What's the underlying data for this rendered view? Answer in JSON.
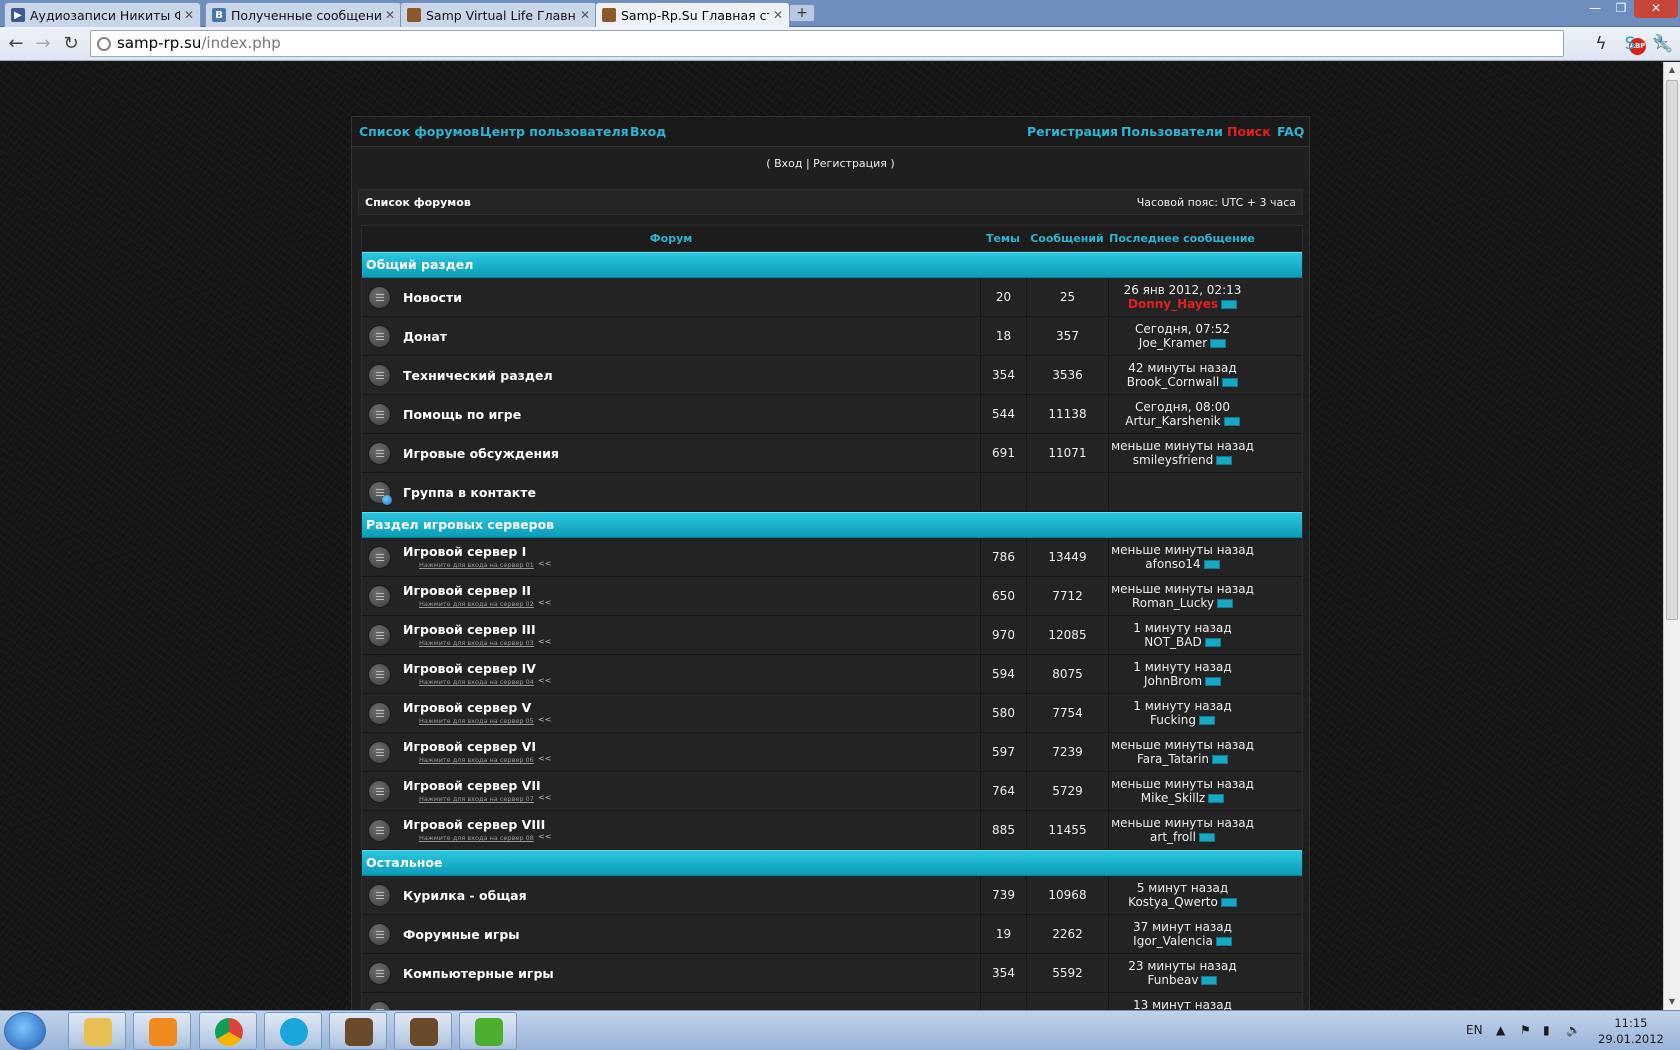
{
  "browser": {
    "tabs": [
      {
        "label": "Аудиозаписи Никиты Фом",
        "favicon": "play-icon",
        "color": "#3a5b8c"
      },
      {
        "label": "Полученные сообщения |",
        "favicon": "vk-icon",
        "color": "#4a76a8"
      },
      {
        "label": "Samp Virtual Life Главная с",
        "favicon": "samp-icon",
        "color": "#8a5a2a"
      },
      {
        "label": "Samp-Rp.Su Главная стран",
        "favicon": "samp-icon",
        "color": "#8a5a2a"
      }
    ],
    "url_host": "samp-rp.su",
    "url_path": "/index.php",
    "abp_label": "ABP"
  },
  "forum": {
    "nav_left": [
      "Список форумов",
      "Центр пользователя",
      "Вход"
    ],
    "nav_right": [
      "Регистрация",
      "Пользователи",
      "Поиск",
      "FAQ"
    ],
    "login_line": "( Вход | Регистрация )",
    "breadcrumb": "Список форумов",
    "timezone": "Часовой пояс: UTC + 3 часа",
    "columns": {
      "forum": "Форум",
      "topics": "Темы",
      "posts": "Сообщений",
      "last": "Последнее сообщение"
    },
    "categories": [
      {
        "title": "Общий раздел",
        "forums": [
          {
            "name": "Новости",
            "topics": "20",
            "posts": "25",
            "last_time": "26 янв 2012, 02:13",
            "last_user": "Donny_Hayes",
            "user_red": true
          },
          {
            "name": "Донат",
            "topics": "18",
            "posts": "357",
            "last_time": "Сегодня, 07:52",
            "last_user": "Joe_Kramer"
          },
          {
            "name": "Технический раздел",
            "topics": "354",
            "posts": "3536",
            "last_time": "42 минуты назад",
            "last_user": "Brook_Cornwall"
          },
          {
            "name": "Помощь по игре",
            "topics": "544",
            "posts": "11138",
            "last_time": "Сегодня, 08:00",
            "last_user": "Artur_Karshenik"
          },
          {
            "name": "Игровые обсуждения",
            "topics": "691",
            "posts": "11071",
            "last_time": "меньше минуты назад",
            "last_user": "smileysfriend"
          },
          {
            "name": "Группа в контакте",
            "link": true
          }
        ]
      },
      {
        "title": "Раздел игровых серверов",
        "forums": [
          {
            "name": "Игровой сервер I",
            "sub": "Нажмите для входа на сервер 01",
            "topics": "786",
            "posts": "13449",
            "last_time": "меньше минуты назад",
            "last_user": "afonso14"
          },
          {
            "name": "Игровой сервер II",
            "sub": "Нажмите для входа на сервер 02",
            "topics": "650",
            "posts": "7712",
            "last_time": "меньше минуты назад",
            "last_user": "Roman_Lucky"
          },
          {
            "name": "Игровой сервер III",
            "sub": "Нажмите для входа на сервер 03",
            "topics": "970",
            "posts": "12085",
            "last_time": "1 минуту назад",
            "last_user": "NOT_BAD"
          },
          {
            "name": "Игровой сервер IV",
            "sub": "Нажмите для входа на сервер 04",
            "topics": "594",
            "posts": "8075",
            "last_time": "1 минуту назад",
            "last_user": "JohnBrom"
          },
          {
            "name": "Игровой сервер V",
            "sub": "Нажмите для входа на сервер 05",
            "topics": "580",
            "posts": "7754",
            "last_time": "1 минуту назад",
            "last_user": "Fucking"
          },
          {
            "name": "Игровой сервер VI",
            "sub": "Нажмите для входа на сервер 06",
            "topics": "597",
            "posts": "7239",
            "last_time": "меньше минуты назад",
            "last_user": "Fara_Tatarin"
          },
          {
            "name": "Игровой сервер VII",
            "sub": "Нажмите для входа на сервер 07",
            "topics": "764",
            "posts": "5729",
            "last_time": "меньше минуты назад",
            "last_user": "Mike_Skillz"
          },
          {
            "name": "Игровой сервер VIII",
            "sub": "Нажмите для входа на сервер 08",
            "topics": "885",
            "posts": "11455",
            "last_time": "меньше минуты назад",
            "last_user": "art_froll"
          }
        ]
      },
      {
        "title": "Остальное",
        "forums": [
          {
            "name": "Курилка - общая",
            "topics": "739",
            "posts": "10968",
            "last_time": "5 минут назад",
            "last_user": "Kostya_Qwerto"
          },
          {
            "name": "Форумные игры",
            "topics": "19",
            "posts": "2262",
            "last_time": "37 минут назад",
            "last_user": "Igor_Valencia"
          },
          {
            "name": "Компьютерные игры",
            "topics": "354",
            "posts": "5592",
            "last_time": "23 минуты назад",
            "last_user": "Funbeav"
          },
          {
            "name": "",
            "topics": "",
            "posts": "",
            "last_time": "13 минут назад",
            "last_user": ""
          }
        ]
      }
    ],
    "sub_arrow": "<<"
  },
  "taskbar": {
    "apps": [
      "file-explorer-icon",
      "media-player-icon",
      "chrome-icon",
      "skype-icon",
      "samp-game-icon",
      "samp-game-icon",
      "green-app-icon"
    ],
    "lang": "EN",
    "time": "11:15",
    "date": "29.01.2012"
  },
  "colors": {
    "accent": "#2fb4cf",
    "category_bar": "#14b2cc",
    "alert_red": "#e02020"
  }
}
